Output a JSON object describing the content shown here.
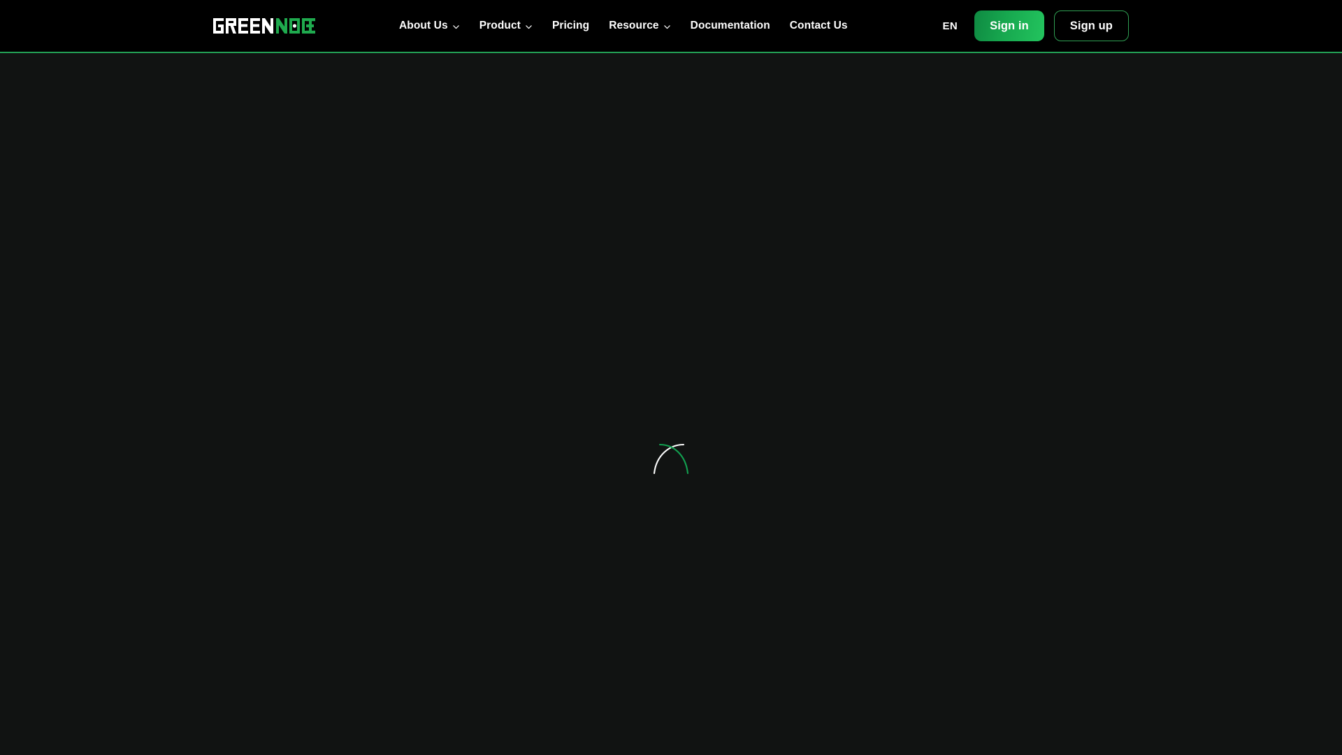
{
  "page": {
    "state": "loading",
    "background_color": "#111312",
    "header_background_color": "#000000",
    "accent_color": "#23a055"
  },
  "header": {
    "logo": {
      "icon_name": "greennode-logo",
      "text_primary": "GREEN",
      "text_secondary": "NODE",
      "primary_color": "#ffffff",
      "secondary_color": "#1faa4e"
    },
    "nav": [
      {
        "label": "About Us",
        "has_dropdown": true,
        "icon": "chevron-down-icon"
      },
      {
        "label": "Product",
        "has_dropdown": true,
        "icon": "chevron-down-icon"
      },
      {
        "label": "Pricing",
        "has_dropdown": false,
        "icon": ""
      },
      {
        "label": "Resource",
        "has_dropdown": true,
        "icon": "chevron-down-icon"
      },
      {
        "label": "Documentation",
        "has_dropdown": false,
        "icon": ""
      },
      {
        "label": "Contact Us",
        "has_dropdown": false,
        "icon": ""
      }
    ],
    "actions": {
      "language": "EN",
      "sign_in_label": "Sign in",
      "sign_up_label": "Sign up",
      "sign_in_color": "#17a84f",
      "sign_up_border_color": "#2f9e52"
    }
  },
  "main": {
    "loading_spinner": {
      "icon_name": "loading-spinner",
      "arc_colors": [
        "#ffffff",
        "#12a150"
      ]
    }
  }
}
